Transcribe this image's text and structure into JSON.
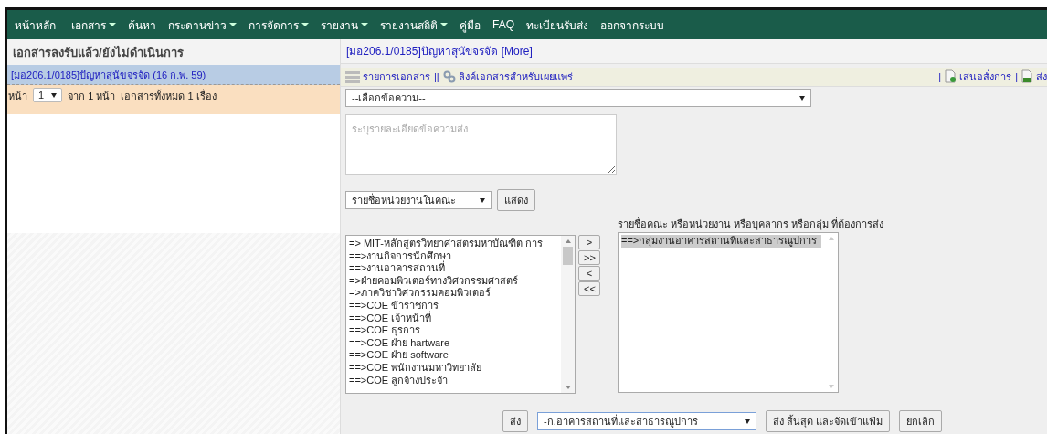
{
  "nav": {
    "items": [
      {
        "label": "หน้าหลัก",
        "dropdown": false
      },
      {
        "label": "เอกสาร",
        "dropdown": true
      },
      {
        "label": "ค้นหา",
        "dropdown": false
      },
      {
        "label": "กระดานข่าว",
        "dropdown": true
      },
      {
        "label": "การจัดการ",
        "dropdown": true
      },
      {
        "label": "รายงาน",
        "dropdown": true
      },
      {
        "label": "รายงานสถิติ",
        "dropdown": true
      },
      {
        "label": "คู่มือ",
        "dropdown": false
      },
      {
        "label": "FAQ",
        "dropdown": false
      },
      {
        "label": "ทะเบียนรับส่ง",
        "dropdown": false
      },
      {
        "label": "ออกจากระบบ",
        "dropdown": false
      }
    ]
  },
  "left_panel": {
    "title": "เอกสารลงรับแล้ว/ยังไม่ดำเนินการ",
    "items": [
      {
        "label": "[มอ206.1/0185]ปัญหาสุนัขจรจัด (16 ก.พ. 59)",
        "selected": true
      }
    ],
    "pagination": {
      "prefix": "หน้า",
      "page": "1",
      "of_pages": "จาก 1 หน้า",
      "total": "เอกสารทั้งหมด 1 เรื่อง"
    }
  },
  "right_panel": {
    "title": "[มอ206.1/0185]ปัญหาสุนัขจรจัด",
    "more_link": "[More]",
    "toolbar_left": [
      {
        "kind": "list",
        "label": "รายการเอกสาร"
      },
      {
        "kind": "separator",
        "label": "||"
      },
      {
        "kind": "share",
        "label": "ลิงค์เอกสารสำหรับเผยแพร่"
      }
    ],
    "toolbar_right": [
      {
        "kind": "separator",
        "label": "|"
      },
      {
        "kind": "propose",
        "label": "เสนอสั่งการ"
      },
      {
        "kind": "separator",
        "label": "|"
      },
      {
        "kind": "send",
        "label": "ส่ง"
      }
    ],
    "message_select": {
      "value": "--เลือกข้อความ--"
    },
    "detail_field": {
      "placeholder": "ระบุรายละเอียดข้อความส่ง"
    },
    "unit_select": {
      "value": "รายชื่อหน่วยงานในคณะ"
    },
    "show_button": "แสดง",
    "source_list": {
      "items": [
        {
          "label": "=> MIT-หลักสูตรวิทยาศาสตรมหาบัณฑิต การ",
          "selected": false
        },
        {
          "label": "==>งานกิจการนักศึกษา",
          "selected": false
        },
        {
          "label": "==>งานอาคารสถานที่",
          "selected": false
        },
        {
          "label": "=>ฝ่ายคอมพิวเตอร์ทางวิศวกรรมศาสตร์",
          "selected": false
        },
        {
          "label": "=>ภาควิชาวิศวกรรมคอมพิวเตอร์",
          "selected": false
        },
        {
          "label": "==>COE ข้าราชการ",
          "selected": false
        },
        {
          "label": "==>COE เจ้าหน้าที่",
          "selected": false
        },
        {
          "label": "==>COE ธุรการ",
          "selected": false
        },
        {
          "label": "==>COE ฝ่าย hartware",
          "selected": false
        },
        {
          "label": "==>COE ฝ่าย software",
          "selected": false
        },
        {
          "label": "==>COE พนักงานมหาวิทยาลัย",
          "selected": false
        },
        {
          "label": "==>COE ลูกจ้างประจำ",
          "selected": false
        }
      ]
    },
    "transfer_buttons": [
      ">",
      ">>",
      "<",
      "<<"
    ],
    "recipients_label": "รายชื่อคณะ หรือหน่วยงาน หรือบุคลากร หรือกลุ่ม ที่ต้องการส่ง",
    "target_list": {
      "items": [
        {
          "label": "==>กลุ่มงานอาคารสถานที่และสาธารณูปการ",
          "selected": true
        }
      ]
    },
    "footer": {
      "send_button": "ส่ง",
      "group_select": {
        "value": "-ก.อาคารสถานที่และสาธารณูปการ"
      },
      "finish_button": "ส่ง สิ้นสุด และจัดเข้าแฟ้ม",
      "cancel_button": "ยกเลิก"
    }
  }
}
